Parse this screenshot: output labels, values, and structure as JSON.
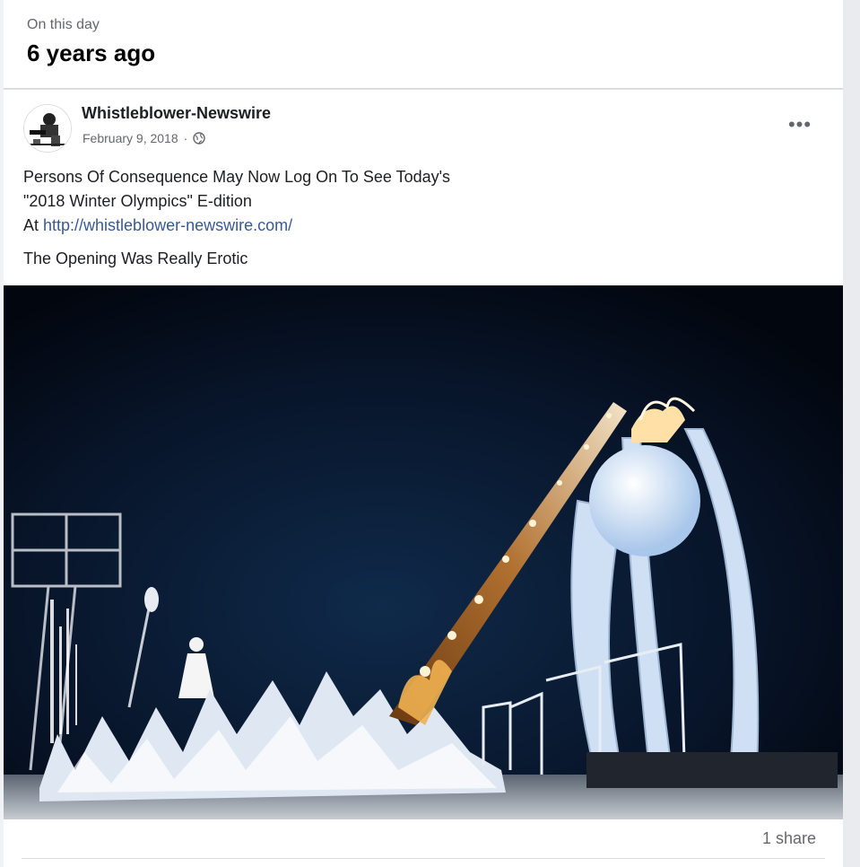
{
  "on_this_day": {
    "label": "On this day",
    "years_ago": "6 years ago"
  },
  "post": {
    "author": "Whistleblower-Newswire",
    "date": "February 9, 2018",
    "audience_icon": "globe-icon",
    "more_label": "•••",
    "text_line1": "Persons Of Consequence May Now Log On To See Today's",
    "text_line2": "\"2018 Winter Olympics\" E-dition",
    "text_prefix": "At ",
    "link": "http://whistleblower-newswire.com/",
    "text_line4": "The Opening Was Really Erotic",
    "shares": "1 share"
  },
  "colors": {
    "link": "#385898",
    "photo_background": "#050c18"
  }
}
